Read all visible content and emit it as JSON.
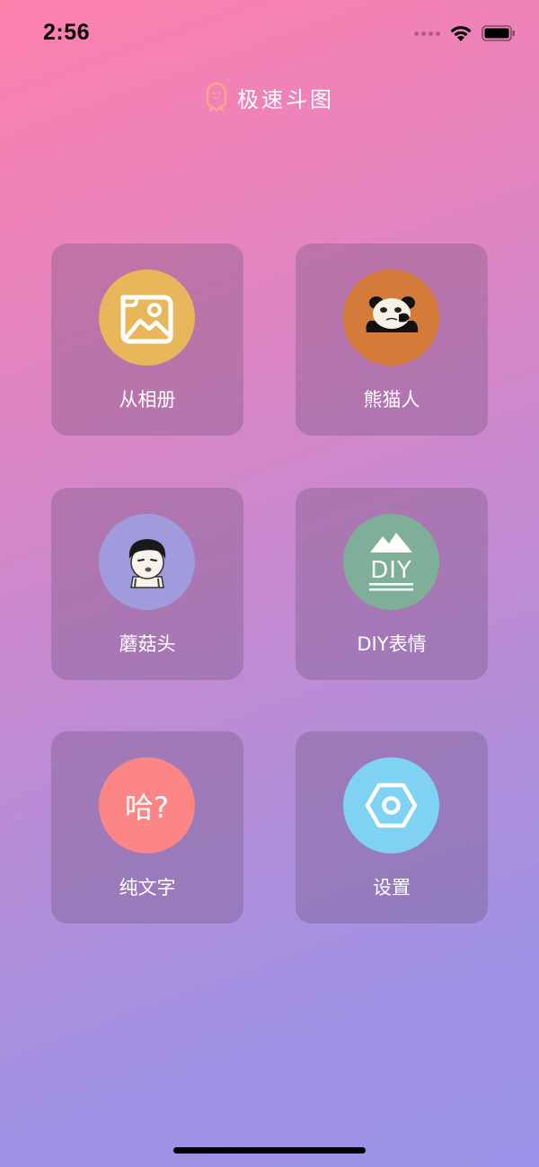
{
  "status_bar": {
    "time": "2:56"
  },
  "header": {
    "title": "极速斗图",
    "logo_icon": "ghost-logo-icon"
  },
  "tiles": [
    {
      "label": "从相册",
      "icon": "photo-album-icon",
      "color": "#e9b75b"
    },
    {
      "label": "熊猫人",
      "icon": "panda-meme-icon",
      "color": "#d57b39"
    },
    {
      "label": "蘑菇头",
      "icon": "mushroom-head-icon",
      "color": "#a09bdc"
    },
    {
      "label": "DIY表情",
      "icon": "diy-mountain-icon",
      "color": "#7faf98"
    },
    {
      "label": "纯文字",
      "icon": "text-icon",
      "color": "#fc8585",
      "icon_text": "哈?"
    },
    {
      "label": "设置",
      "icon": "hexagon-settings-icon",
      "color": "#7fd2f4"
    }
  ],
  "colors": {
    "gradient_start": "#fd80ac",
    "gradient_end": "#9a92e8",
    "logo_accent": "#f7a98c"
  }
}
